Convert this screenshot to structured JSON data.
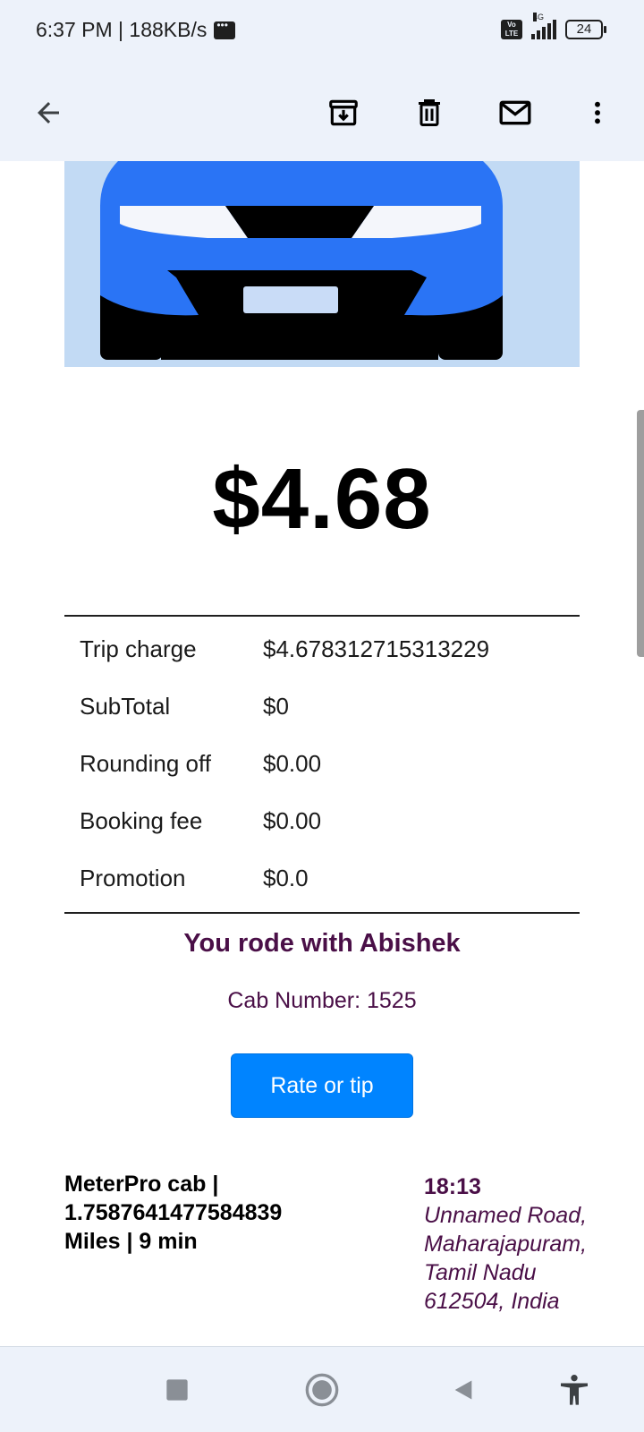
{
  "status_bar": {
    "time_speed": "6:37 PM | 188KB/s",
    "network_label": "4G",
    "volte_label": "Vo LTE",
    "battery": "24"
  },
  "app_bar": {
    "icons": [
      "back-arrow-icon",
      "archive-icon",
      "delete-icon",
      "mail-icon",
      "more-vert-icon"
    ]
  },
  "receipt": {
    "total": "$4.68",
    "fare_rows": [
      {
        "label": "Trip charge",
        "value": "$4.678312715313229"
      },
      {
        "label": "SubTotal",
        "value": "$0"
      },
      {
        "label": "Rounding off",
        "value": "$0.00"
      },
      {
        "label": "Booking fee",
        "value": "$0.00"
      },
      {
        "label": "Promotion",
        "value": "$0.0"
      }
    ],
    "driver_line": "You rode with Abishek",
    "cab_number": "Cab Number: 1525",
    "rate_button": "Rate or tip",
    "trip_summary_1": "MeterPro cab |",
    "trip_summary_2": "1.7587641477584839",
    "trip_summary_3": "Miles | 9 min",
    "trip_time": "18:13",
    "address_1": "Unnamed Road,",
    "address_2": "Maharajapuram,",
    "address_3": "Tamil Nadu",
    "address_4": "612504, India"
  },
  "colors": {
    "accent": "#0084ff",
    "driver_text": "#4a0f47",
    "car_body": "#2a74f5",
    "banner_bg": "#c2daf4",
    "bar_bg": "#edf2fa"
  }
}
